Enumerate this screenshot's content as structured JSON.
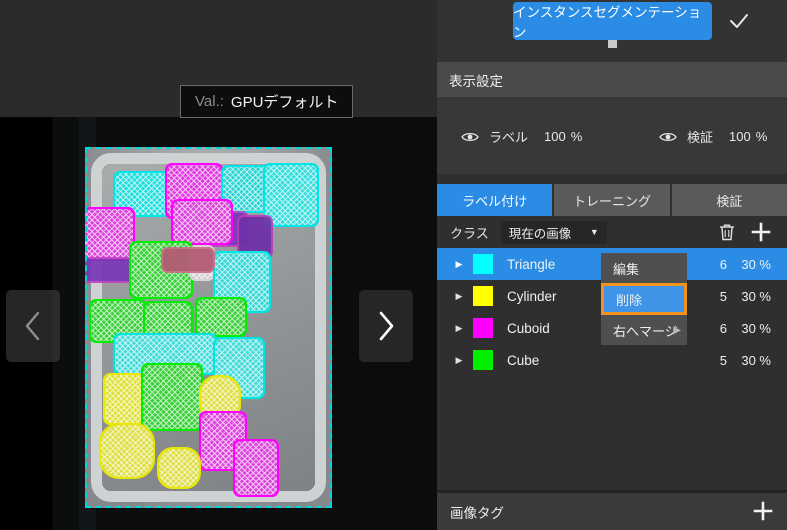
{
  "viewer": {
    "value_prefix": "Val.:",
    "value_text": "GPUデフォルト",
    "prev_icon": "chevron-left-icon",
    "next_icon": "chevron-right-icon"
  },
  "panel": {
    "mode_button": "インスタンスセグメンテーション",
    "confirm_icon": "checkmark-icon",
    "display_settings_header": "表示設定",
    "visibility": [
      {
        "icon": "eye-icon",
        "label": "ラベル",
        "value": "100",
        "unit": "%"
      },
      {
        "icon": "eye-icon",
        "label": "検証",
        "value": "100",
        "unit": "%"
      }
    ],
    "tabs": [
      {
        "label": "ラベル付け",
        "active": true
      },
      {
        "label": "トレーニング",
        "active": false
      },
      {
        "label": "検証",
        "active": false
      }
    ],
    "class_toolbar": {
      "label": "クラス",
      "scope_value": "現在の画像",
      "scope_caret": "▼",
      "delete_icon": "trash-icon",
      "add_icon": "plus-icon"
    },
    "classes": [
      {
        "caret": "▶",
        "color": "#00FFFF",
        "name": "Triangle",
        "count": "6",
        "percent": "30 %",
        "selected": true
      },
      {
        "caret": "▶",
        "color": "#FFFF00",
        "name": "Cylinder",
        "count": "5",
        "percent": "30 %",
        "selected": false
      },
      {
        "caret": "▶",
        "color": "#FF00FF",
        "name": "Cuboid",
        "count": "6",
        "percent": "30 %",
        "selected": false
      },
      {
        "caret": "▶",
        "color": "#00EE00",
        "name": "Cube",
        "count": "5",
        "percent": "30 %",
        "selected": false
      }
    ],
    "context_menu": [
      {
        "label": "編集",
        "highlighted": false,
        "submenu": false
      },
      {
        "label": "削除",
        "highlighted": true,
        "submenu": false
      },
      {
        "label": "右へマージ",
        "highlighted": false,
        "submenu": true,
        "arrow": "▶"
      }
    ],
    "image_tags": {
      "label": "画像タグ",
      "add_icon": "plus-icon"
    }
  },
  "colors": {
    "accent": "#2b8ce5",
    "highlight_border": "#f2941b",
    "panel_bg": "#2f2f2f",
    "marquee": "#00d7d7"
  }
}
